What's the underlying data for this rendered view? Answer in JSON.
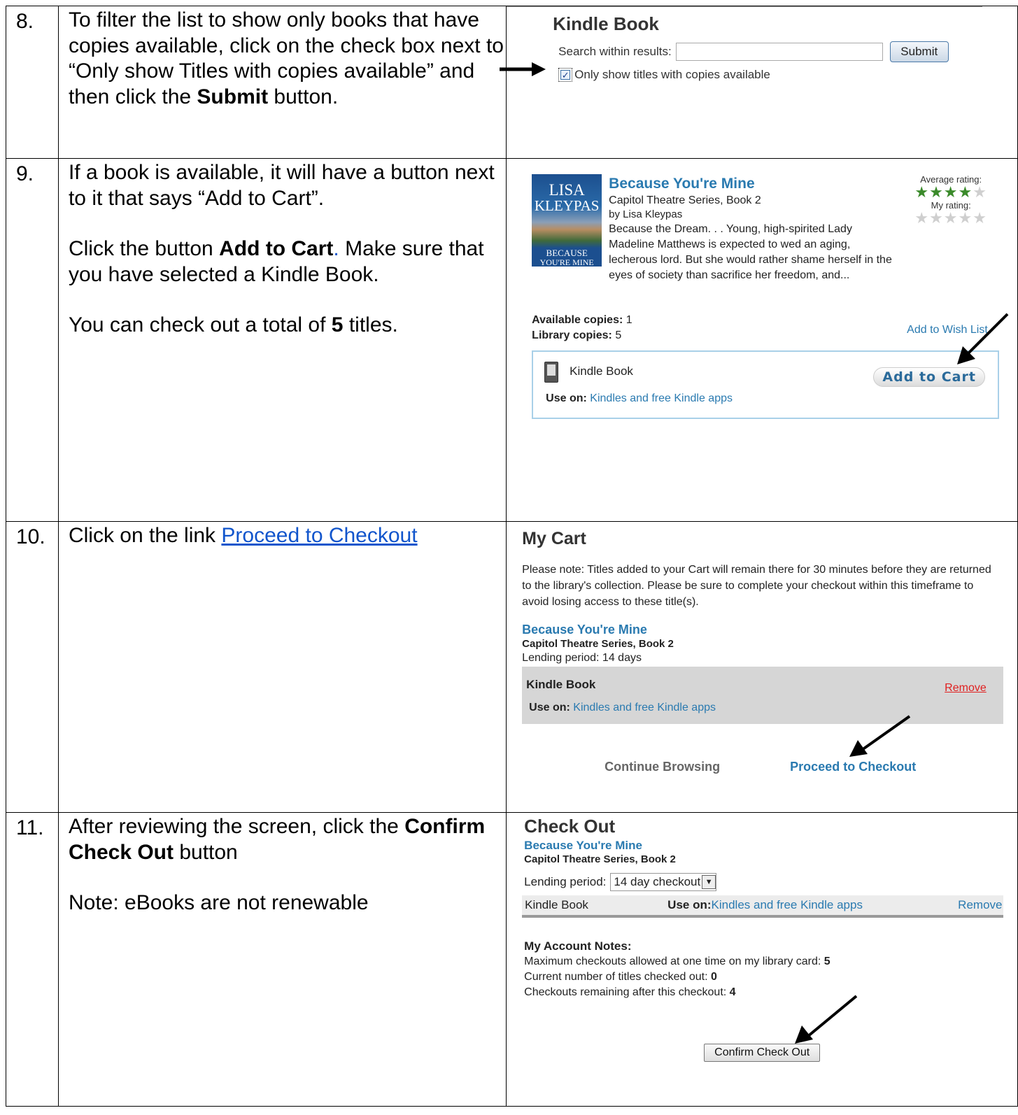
{
  "steps": [
    {
      "num": "8.",
      "text": {
        "line1_a": "To filter the list to show only books that have copies available, click on the check box next to “Only show Titles with copies available” and then click the ",
        "line1_bold": "Submit",
        "line1_b": " button."
      },
      "shot": {
        "heading": "Kindle Book",
        "search_label": "Search within results:",
        "search_value": "",
        "submit_label": "Submit",
        "checkbox_label": "Only show titles with copies available",
        "checkbox_checked": true
      }
    },
    {
      "num": "9.",
      "text": {
        "p1": "If a book is available, it will have a button next to it that says “Add to Cart”.",
        "p2_a": "Click the button ",
        "p2_bold": "Add to Cart",
        "p2_dot": ".",
        "p2_b": " Make sure that you have selected a Kindle Book.",
        "p3_a": "You can check out a total of ",
        "p3_bold": "5",
        "p3_b": " titles."
      },
      "shot": {
        "cover_author_line1": "LISA",
        "cover_author_line2": "KLEYPAS",
        "cover_title_line1": "BECAUSE",
        "cover_title_line2": "YOU'RE MINE",
        "title": "Because You're Mine",
        "series": "Capitol Theatre Series, Book 2",
        "author": "by Lisa Kleypas",
        "description": "Because the Dream. . . Young, high-spirited Lady Madeline Matthews is expected to wed an aging, lecherous lord. But she would rather shame herself in the eyes of society than sacrifice her freedom, and...",
        "avg_rating_label": "Average rating:",
        "avg_rating": 4.5,
        "my_rating_label": "My rating:",
        "my_rating": 0,
        "available_label": "Available copies:",
        "available_value": "1",
        "library_label": "Library copies:",
        "library_value": "5",
        "wishlist": "Add to Wish List",
        "format": "Kindle Book",
        "use_on_label": "Use on:",
        "use_on_value": "Kindles and free Kindle apps",
        "add_to_cart": "Add to Cart"
      }
    },
    {
      "num": "10.",
      "text": {
        "a": "Click on the link ",
        "link": "Proceed to Checkout"
      },
      "shot": {
        "heading": "My Cart",
        "note": "Please note: Titles added to your Cart will remain there for 30 minutes before they are returned to the library's collection. Please be sure to complete your checkout within this timeframe to avoid losing access to these title(s).",
        "title": "Because You're Mine",
        "series": "Capitol Theatre Series, Book 2",
        "lending": "Lending period: 14 days",
        "format": "Kindle Book",
        "remove": "Remove",
        "use_on_label": "Use on:",
        "use_on_value": "Kindles and free Kindle apps",
        "continue": "Continue Browsing",
        "proceed": "Proceed to Checkout"
      }
    },
    {
      "num": "11.",
      "text": {
        "a": "After reviewing the screen, click the ",
        "bold": "Confirm Check Out",
        "b": " button",
        "note": "Note:  eBooks are not renewable"
      },
      "shot": {
        "heading": "Check Out",
        "title": "Because You're Mine",
        "series": "Capitol Theatre Series, Book 2",
        "lending_label": "Lending period:",
        "lending_value": "14 day checkout",
        "format": "Kindle Book",
        "use_on_label": "Use on:",
        "use_on_value": "Kindles and free Kindle apps",
        "remove": "Remove",
        "notes_heading": "My Account Notes:",
        "max_label": "Maximum checkouts allowed at one time on my library card:",
        "max_value": "5",
        "current_label": "Current number of titles checked out:",
        "current_value": "0",
        "remaining_label": "Checkouts remaining after this checkout:",
        "remaining_value": "4",
        "confirm": "Confirm Check Out"
      }
    }
  ]
}
